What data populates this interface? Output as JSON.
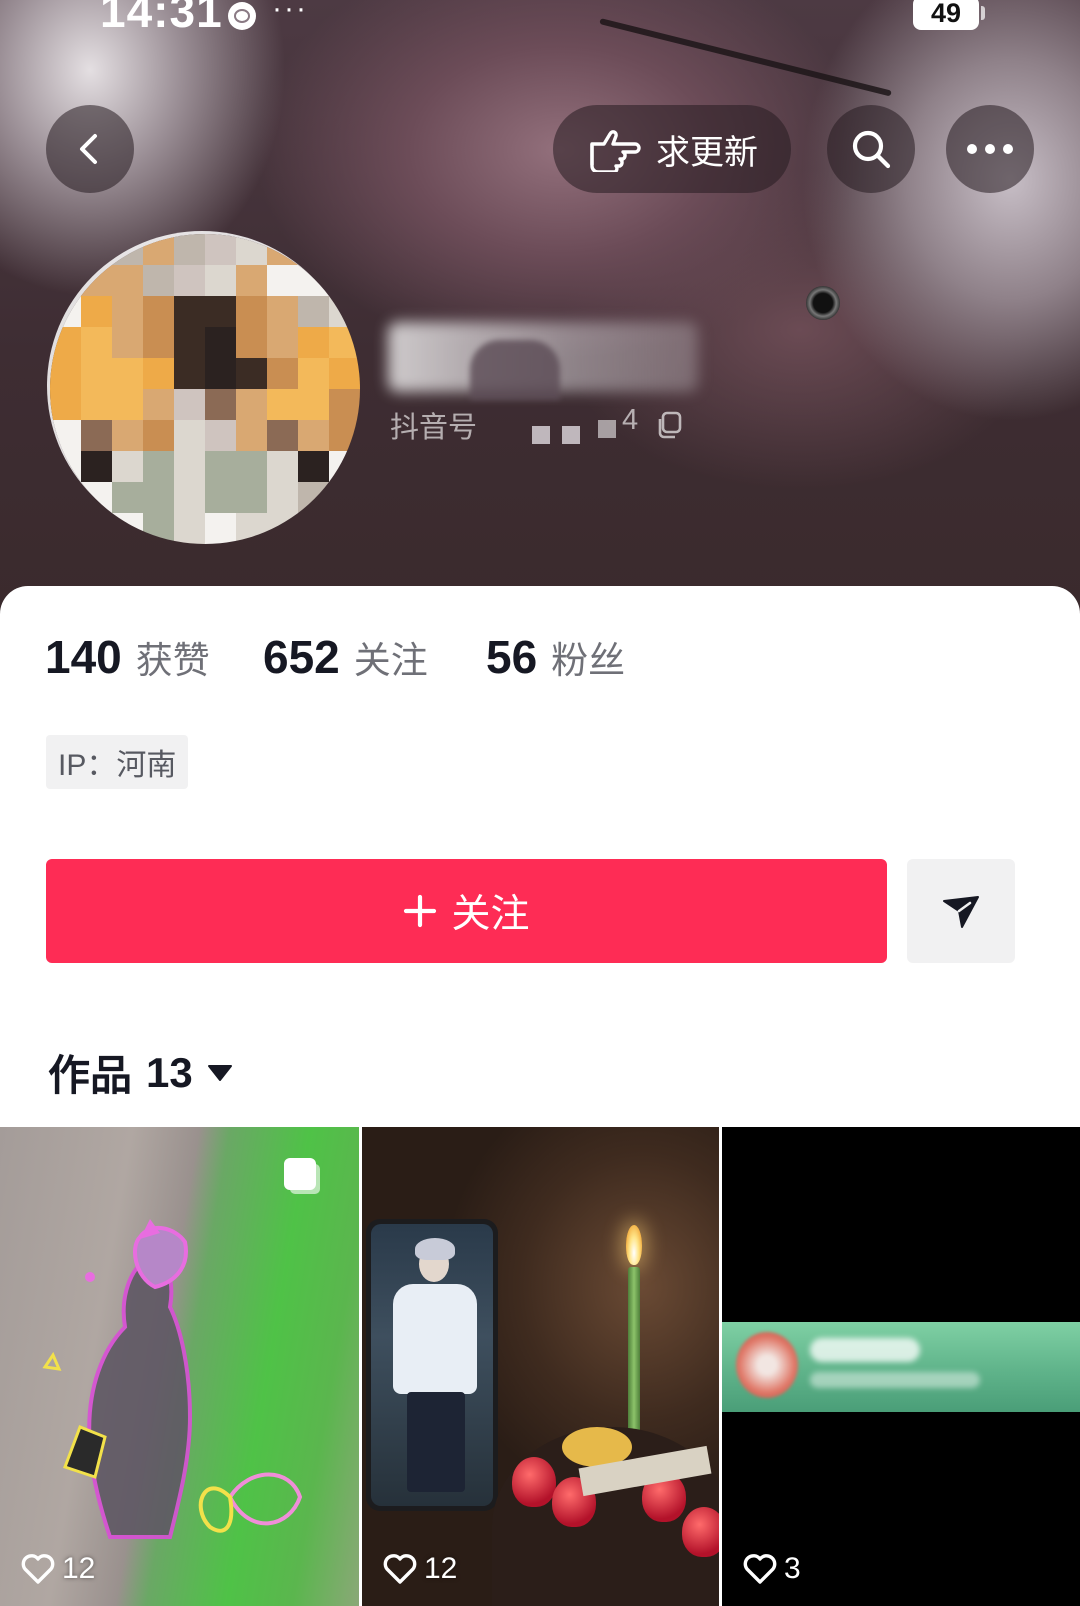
{
  "status_bar": {
    "time": "14:31",
    "battery": "49",
    "menu_dots": "···"
  },
  "header": {
    "back_icon": "chevron-left-icon",
    "request_update": {
      "label": "求更新",
      "icon": "pointing-hand-icon"
    },
    "search_icon": "search-icon",
    "more_icon": "more-icon"
  },
  "profile": {
    "douyin_id_label": "抖音号",
    "douyin_id_visible_tail": "4",
    "copy_icon": "copy-icon"
  },
  "stats": [
    {
      "value": "140",
      "label": "获赞"
    },
    {
      "value": "652",
      "label": "关注"
    },
    {
      "value": "56",
      "label": "粉丝"
    }
  ],
  "ip_tag": "IP：河南",
  "follow_button": {
    "label": "关注",
    "icon": "plus-icon"
  },
  "share_button": {
    "icon": "send-icon"
  },
  "works": {
    "label": "作品",
    "count": "13",
    "icon": "caret-down-icon"
  },
  "grid": [
    {
      "likes": "12",
      "multi_image": true
    },
    {
      "likes": "12"
    },
    {
      "likes": "3"
    }
  ],
  "colors": {
    "accent": "#fe2c55",
    "text": "#161823",
    "tag_bg": "#f1f1f2",
    "card_bg": "#ffffff"
  }
}
